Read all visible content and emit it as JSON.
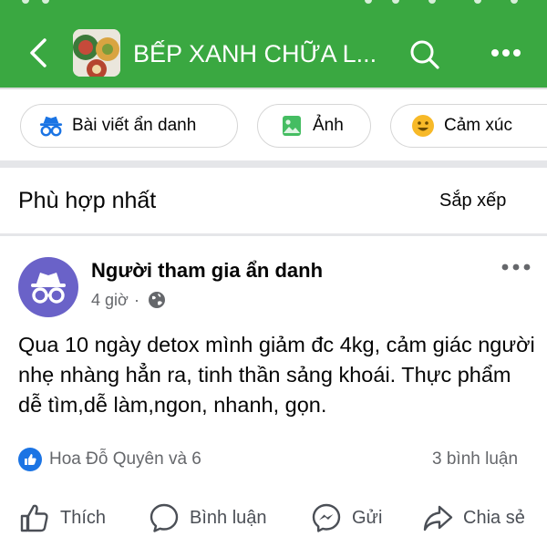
{
  "header": {
    "group_name": "BẾP XANH CHỮA L...",
    "back_icon": "chevron-left-icon",
    "search_icon": "search-icon",
    "more_icon": "more-horizontal-icon",
    "accent_color": "#3aa841"
  },
  "composer_chips": [
    {
      "label": "Bài viết ẩn danh",
      "icon": "incognito-icon"
    },
    {
      "label": "Ảnh",
      "icon": "photo-icon"
    },
    {
      "label": "Cảm xúc",
      "icon": "smiley-icon"
    }
  ],
  "feed": {
    "sort_title": "Phù hợp nhất",
    "sort_button": "Sắp xếp"
  },
  "post": {
    "author": "Người tham gia ẩn danh",
    "time": "4 giờ",
    "time_separator": "·",
    "privacy_icon": "globe-icon",
    "text": "Qua 10 ngày detox mình giảm đc 4kg, cảm giác người nhẹ nhàng hẳn ra, tinh thần sảng khoái. Thực phẩm dễ tìm,dễ làm,ngon, nhanh, gọn.",
    "reactions": "Hoa Đỗ Quyên và 6",
    "comments": "3 bình luận"
  },
  "actions": [
    {
      "label": "Thích",
      "icon": "thumbs-up-icon"
    },
    {
      "label": "Bình luận",
      "icon": "comment-icon"
    },
    {
      "label": "Gửi",
      "icon": "messenger-icon"
    },
    {
      "label": "Chia sẻ",
      "icon": "share-icon"
    }
  ]
}
